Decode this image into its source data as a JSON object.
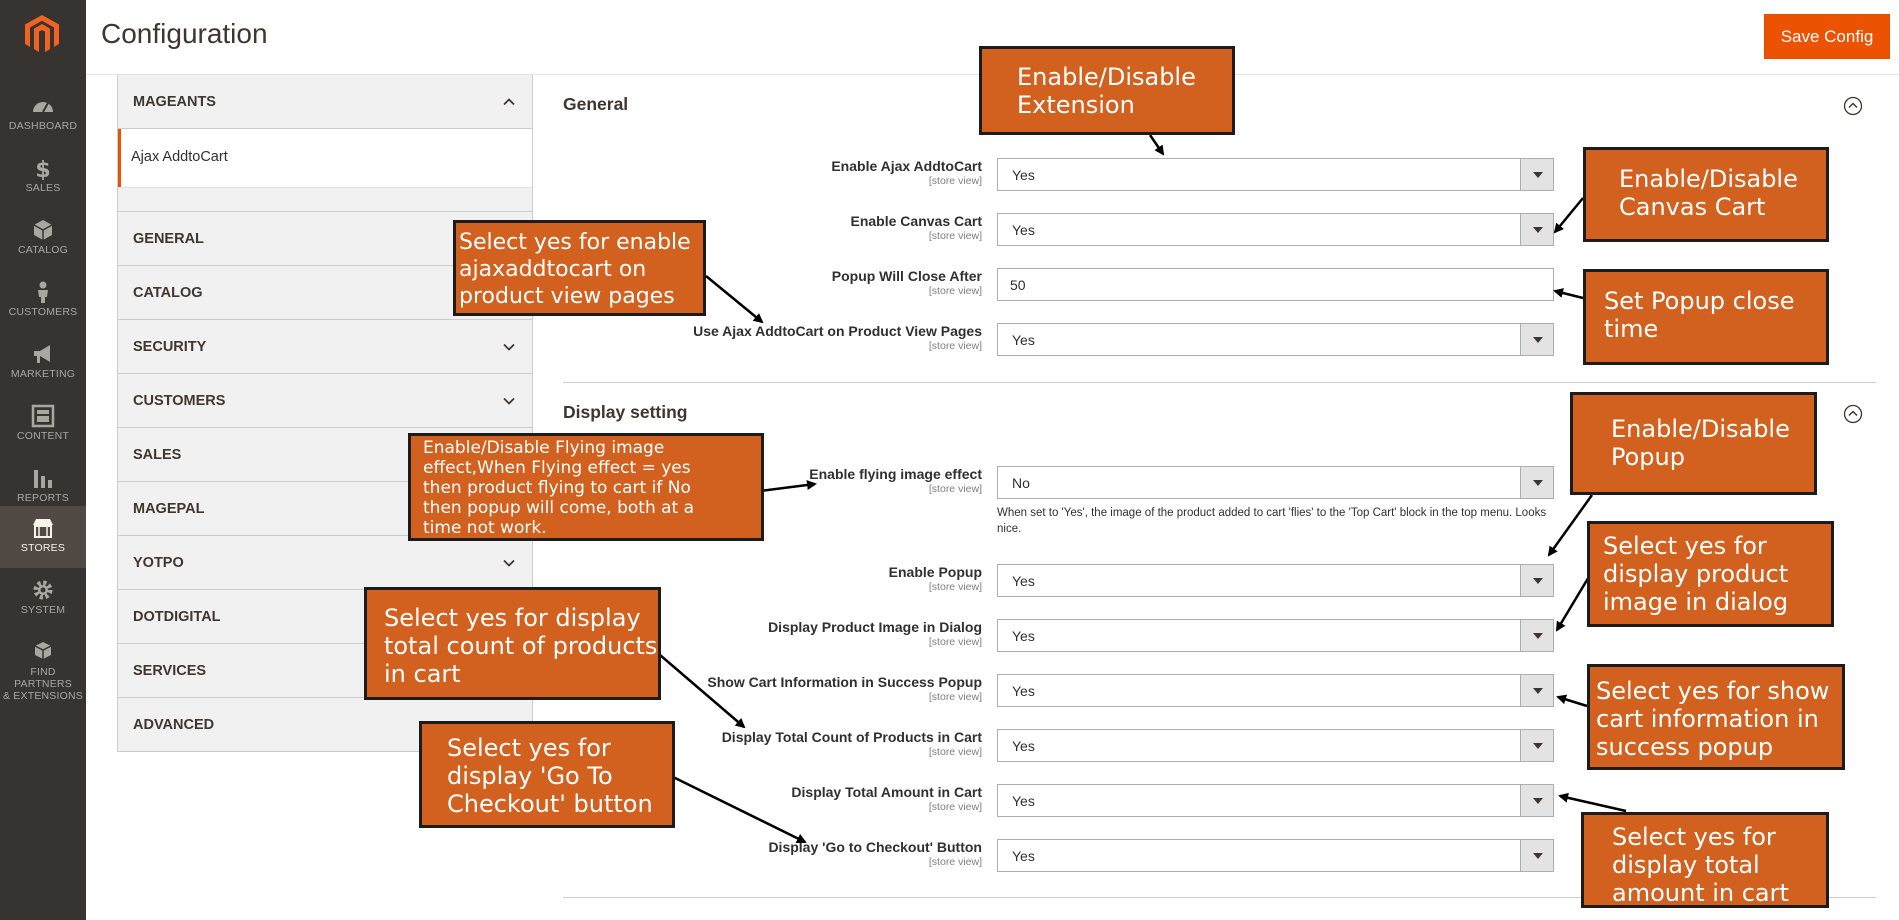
{
  "sidebar": {
    "items": [
      {
        "label": "DASHBOARD",
        "icon": "dashboard-icon"
      },
      {
        "label": "SALES",
        "icon": "dollar-icon"
      },
      {
        "label": "CATALOG",
        "icon": "box-icon"
      },
      {
        "label": "CUSTOMERS",
        "icon": "person-icon"
      },
      {
        "label": "MARKETING",
        "icon": "megaphone-icon"
      },
      {
        "label": "CONTENT",
        "icon": "layout-icon"
      },
      {
        "label": "REPORTS",
        "icon": "bar-chart-icon"
      },
      {
        "label": "STORES",
        "icon": "store-icon"
      },
      {
        "label": "SYSTEM",
        "icon": "gear-icon"
      },
      {
        "label": "FIND PARTNERS\n& EXTENSIONS",
        "icon": "cubes-icon"
      }
    ]
  },
  "header": {
    "title": "Configuration",
    "save_label": "Save Config"
  },
  "tabs": {
    "group": "MAGEANTS",
    "active_item": "Ajax AddtoCart",
    "items": [
      "GENERAL",
      "CATALOG",
      "SECURITY",
      "CUSTOMERS",
      "SALES",
      "MAGEPAL",
      "YOTPO",
      "DOTDIGITAL",
      "SERVICES",
      "ADVANCED"
    ]
  },
  "scope_label": "[store view]",
  "general": {
    "title": "General",
    "rows": [
      {
        "label": "Enable Ajax AddtoCart",
        "value": "Yes"
      },
      {
        "label": "Enable Canvas Cart",
        "value": "Yes"
      },
      {
        "label": "Popup Will Close After",
        "value": "50"
      },
      {
        "label": "Use Ajax AddtoCart on Product View Pages",
        "value": "Yes"
      }
    ]
  },
  "display": {
    "title": "Display setting",
    "note": "When set to 'Yes', the image of the product added to cart 'flies' to the 'Top Cart' block in the top menu. Looks nice.",
    "rows": [
      {
        "label": "Enable flying image effect",
        "value": "No"
      },
      {
        "label": "Enable Popup",
        "value": "Yes"
      },
      {
        "label": "Display Product Image in Dialog",
        "value": "Yes"
      },
      {
        "label": "Show Cart Information in Success Popup",
        "value": "Yes"
      },
      {
        "label": "Display Total Count of Products in Cart",
        "value": "Yes"
      },
      {
        "label": "Display Total Amount in Cart",
        "value": "Yes"
      },
      {
        "label": "Display 'Go to Checkout' Button",
        "value": "Yes"
      }
    ]
  },
  "annotations": [
    "Enable/Disable\nExtension",
    "Enable/Disable\nCanvas Cart",
    "Select yes for enable\najaxaddtocart on\nproduct view pages",
    "Set Popup close\ntime",
    "Enable/Disable Flying image\neffect,When Flying effect = yes\n then product flying to cart if No\nthen popup will come, both at a\ntime not work.",
    "Enable/Disable\nPopup",
    "Select yes for\ndisplay product\nimage in dialog",
    "Select yes for display\ntotal count of products\n in cart",
    "Select yes for show\ncart information in\n success popup",
    "Select yes for\ndisplay 'Go To\nCheckout' button",
    "Select yes for\ndisplay total\n amount in cart"
  ],
  "colors": {
    "accent": "#eb5202",
    "sidebar": "#373330",
    "callout": "#d2601f"
  }
}
